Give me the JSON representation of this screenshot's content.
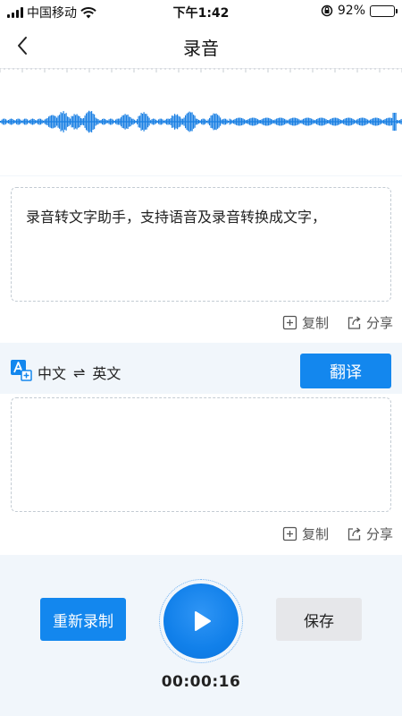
{
  "status_bar": {
    "carrier": "中国移动",
    "time": "下午1:42",
    "battery_percent": "92%",
    "battery_level": 0.92,
    "icons": [
      "signal-icon",
      "wifi-icon",
      "orientation-lock-icon",
      "battery-icon"
    ]
  },
  "nav": {
    "title": "录音",
    "back_icon": "chevron-left-icon"
  },
  "transcript": {
    "text": "录音转文字助手，支持语音及录音转换成文字，",
    "copy_label": "复制",
    "share_label": "分享"
  },
  "translation": {
    "source_lang": "中文",
    "swap_symbol": "⇌",
    "target_lang": "英文",
    "translate_label": "翻译",
    "text": "",
    "copy_label": "复制",
    "share_label": "分享"
  },
  "controls": {
    "rerecord_label": "重新录制",
    "save_label": "保存",
    "play_icon": "play-icon",
    "timer": "00:00:16"
  },
  "colors": {
    "accent": "#1387ee",
    "waveform": "#1a7fe3",
    "background": "#f1f6fb",
    "save_button": "#e6e7ea"
  }
}
